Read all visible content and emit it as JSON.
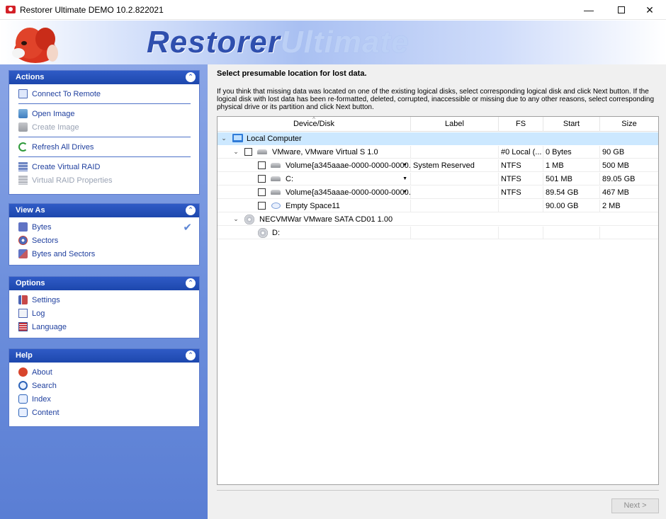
{
  "window": {
    "title": "Restorer Ultimate DEMO 10.2.822021",
    "minimize": "—",
    "close": "✕"
  },
  "banner": {
    "word1": "Restorer",
    "word2": "Ultimate"
  },
  "sidebar": {
    "actions": {
      "title": "Actions",
      "collapse": "⌃",
      "items": [
        {
          "label": "Connect To Remote",
          "icon": "monitor-icon"
        },
        {
          "label": "Open Image",
          "icon": "disk-icon"
        },
        {
          "label": "Create Image",
          "icon": "disk-icon",
          "disabled": true
        },
        {
          "label": "Refresh All Drives",
          "icon": "refresh-icon"
        },
        {
          "label": "Create Virtual RAID",
          "icon": "raid-icon"
        },
        {
          "label": "Virtual RAID Properties",
          "icon": "raid-icon",
          "disabled": true
        }
      ]
    },
    "view_as": {
      "title": "View As",
      "collapse": "⌃",
      "items": [
        {
          "label": "Bytes",
          "icon": "bytes-icon",
          "checked": true
        },
        {
          "label": "Sectors",
          "icon": "sectors-icon"
        },
        {
          "label": "Bytes and Sectors",
          "icon": "bytes-sectors-icon"
        }
      ],
      "check_glyph": "✔"
    },
    "options": {
      "title": "Options",
      "collapse": "⌃",
      "items": [
        {
          "label": "Settings",
          "icon": "settings-icon"
        },
        {
          "label": "Log",
          "icon": "log-icon"
        },
        {
          "label": "Language",
          "icon": "language-icon"
        }
      ]
    },
    "help": {
      "title": "Help",
      "collapse": "⌃",
      "items": [
        {
          "label": "About",
          "icon": "about-icon"
        },
        {
          "label": "Search",
          "icon": "search-icon"
        },
        {
          "label": "Index",
          "icon": "help-icon"
        },
        {
          "label": "Content",
          "icon": "help-icon"
        }
      ]
    }
  },
  "main": {
    "heading": "Select presumable location for lost data.",
    "instructions": "If you think that missing data was located on one of the existing logical disks, select corresponding logical disk and click Next button. If the logical disk with lost data has been re-formatted, deleted, corrupted, inaccessible or missing due to any other reasons, select corresponding physical drive or its partition and click Next button.",
    "columns": {
      "device": "Device/Disk",
      "label": "Label",
      "fs": "FS",
      "start": "Start",
      "size": "Size"
    },
    "rows": [
      {
        "name": "Local Computer",
        "label": "",
        "fs": "",
        "start": "",
        "size": ""
      },
      {
        "name": "VMware, VMware Virtual S 1.0",
        "label": "",
        "fs": "#0 Local (...",
        "start": "0 Bytes",
        "size": "90 GB"
      },
      {
        "name": "Volume{a345aaae-0000-0000-0000...",
        "label": "System Reserved",
        "fs": "NTFS",
        "start": "1 MB",
        "size": "500 MB"
      },
      {
        "name": "C:",
        "label": "",
        "fs": "NTFS",
        "start": "501 MB",
        "size": "89.05 GB"
      },
      {
        "name": "Volume{a345aaae-0000-0000-0000...",
        "label": "",
        "fs": "NTFS",
        "start": "89.54 GB",
        "size": "467 MB"
      },
      {
        "name": "Empty Space11",
        "label": "",
        "fs": "",
        "start": "90.00 GB",
        "size": "2 MB"
      },
      {
        "name": "NECVMWar VMware SATA CD01 1.00",
        "label": "",
        "fs": "",
        "start": "",
        "size": ""
      },
      {
        "name": "D:",
        "label": "",
        "fs": "",
        "start": "",
        "size": ""
      }
    ],
    "next_button": "Next >"
  }
}
